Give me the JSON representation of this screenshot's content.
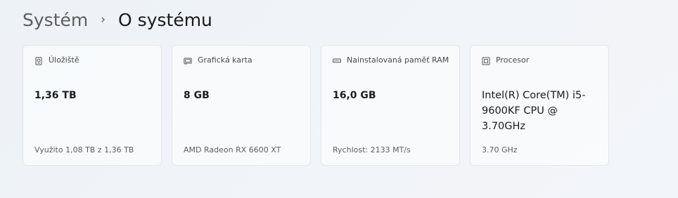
{
  "breadcrumb": {
    "parent": "Systém",
    "separator": "›",
    "current": "O systému"
  },
  "cards": [
    {
      "icon": "storage-icon",
      "title": "Úložiště",
      "value": "1,36 TB",
      "detail": "Využito 1,08 TB z 1,36 TB"
    },
    {
      "icon": "graphics-card-icon",
      "title": "Grafická karta",
      "value": "8 GB",
      "detail": "AMD Radeon RX 6600 XT"
    },
    {
      "icon": "memory-icon",
      "title": "Nainstalovaná paměť RAM",
      "value": "16,0 GB",
      "detail": "Rychlost: 2133 MT/s"
    },
    {
      "icon": "processor-icon",
      "title": "Procesor",
      "value": "Intel(R) Core(TM) i5-9600KF CPU @ 3.70GHz",
      "detail": "3.70 GHz"
    }
  ]
}
